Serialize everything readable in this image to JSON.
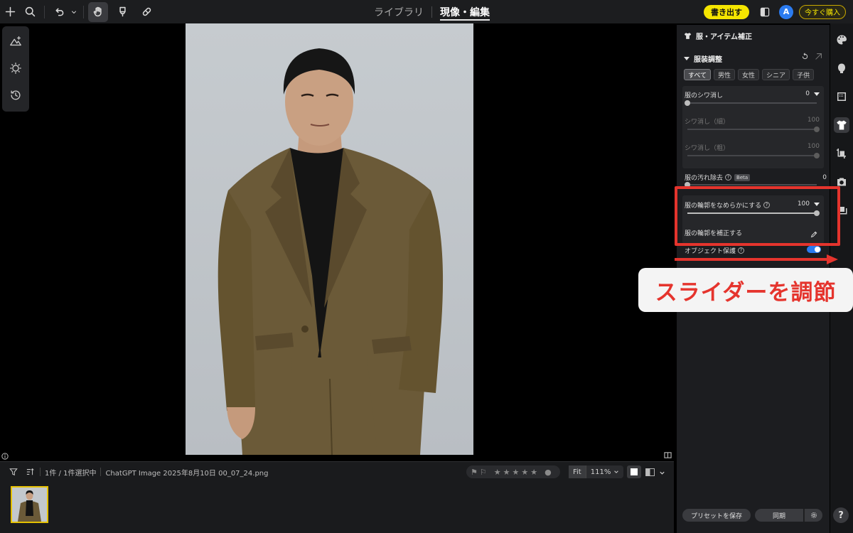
{
  "topbar": {
    "tabs": [
      {
        "label": "ライブラリ"
      },
      {
        "label": "現像・編集"
      }
    ],
    "export_label": "書き出す",
    "avatar_letter": "A",
    "buy_label": "今すぐ購入"
  },
  "filmstrip": {
    "count_text": "1件 / 1件選択中",
    "filename": "ChatGPT Image 2025年8月10日 00_07_24.png",
    "zoom_fit": "Fit",
    "zoom_value": "111%"
  },
  "panel": {
    "title": "服・アイテム補正",
    "section": "服装調整",
    "chips": [
      {
        "label": "すべて"
      },
      {
        "label": "男性"
      },
      {
        "label": "女性"
      },
      {
        "label": "シニア"
      },
      {
        "label": "子供"
      }
    ],
    "wrinkle": {
      "label": "服のシワ消し",
      "value": "0"
    },
    "wrinkle_fine": {
      "label": "シワ消し（細）",
      "value": "100"
    },
    "wrinkle_coarse": {
      "label": "シワ消し（粗）",
      "value": "100"
    },
    "stain": {
      "label": "服の汚れ除去",
      "beta": "Beta",
      "value": "0"
    },
    "smooth": {
      "label": "服の輪郭をなめらかにする",
      "value": "100"
    },
    "correct": {
      "label": "服の輪郭を補正する"
    },
    "protect": {
      "label": "オブジェクト保護"
    },
    "save_preset": "プリセットを保存",
    "sync": "同期"
  },
  "annotation": {
    "callout": "スライダーを調節",
    "color": "#e5342d"
  },
  "help_label": "?"
}
